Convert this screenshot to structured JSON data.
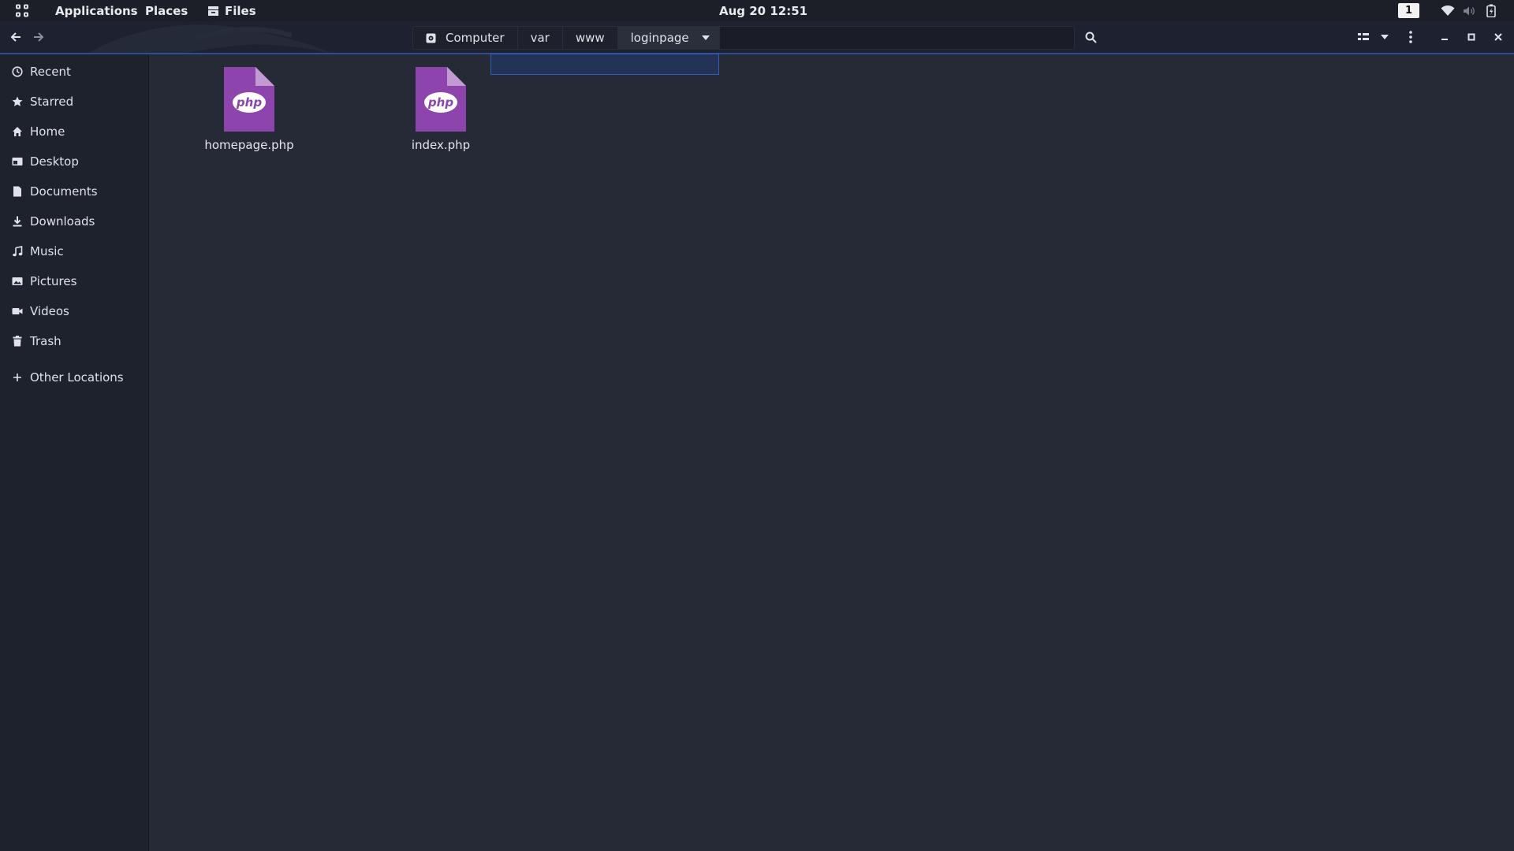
{
  "topbar": {
    "applications_label": "Applications",
    "places_label": "Places",
    "files_label": "Files",
    "datetime": "Aug 20  12:51",
    "workspace_number": "1"
  },
  "pathbar": {
    "crumbs": [
      "Computer",
      "var",
      "www",
      "loginpage"
    ]
  },
  "sidebar": {
    "items": [
      {
        "label": "Recent",
        "icon": "clock-icon"
      },
      {
        "label": "Starred",
        "icon": "star-icon"
      },
      {
        "label": "Home",
        "icon": "home-icon"
      },
      {
        "label": "Desktop",
        "icon": "desktop-icon"
      },
      {
        "label": "Documents",
        "icon": "document-icon"
      },
      {
        "label": "Downloads",
        "icon": "download-icon"
      },
      {
        "label": "Music",
        "icon": "music-icon"
      },
      {
        "label": "Pictures",
        "icon": "picture-icon"
      },
      {
        "label": "Videos",
        "icon": "video-icon"
      },
      {
        "label": "Trash",
        "icon": "trash-icon"
      },
      {
        "label": "Other Locations",
        "icon": "plus-icon"
      }
    ]
  },
  "files": [
    {
      "name": "homepage.php",
      "type": "php"
    },
    {
      "name": "index.php",
      "type": "php"
    }
  ],
  "file_badge_text": "php",
  "colors": {
    "background": "#262a36",
    "sidebar": "#1e222c",
    "php_icon": "#8e44ad",
    "accent": "#2e4f8f"
  }
}
